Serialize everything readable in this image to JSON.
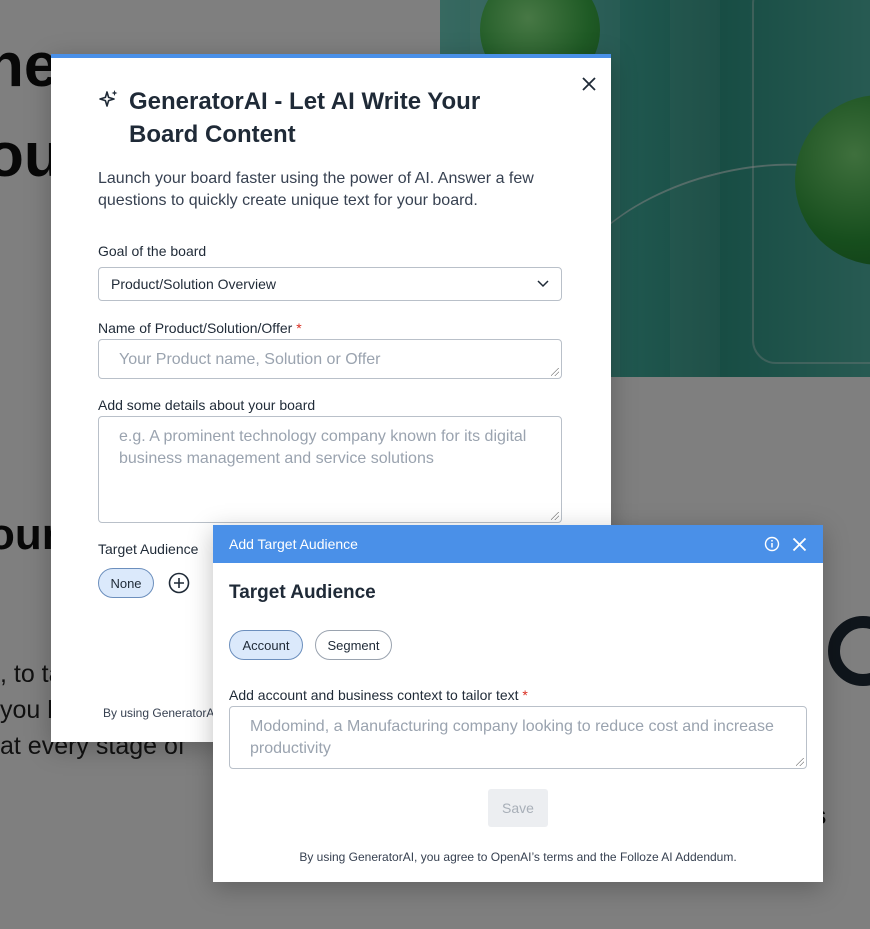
{
  "background_page": {
    "hero_line_1": "he",
    "hero_line_2": "ou",
    "section_heading": "our",
    "body_line_1": ", to ta",
    "body_line_2": "you b",
    "body_line_3": "at every stage of",
    "right_fragment": "s"
  },
  "main_modal": {
    "title": "GeneratorAI - Let AI Write Your Board Content",
    "subtitle": "Launch your board faster using the power of AI. Answer a few questions to quickly create unique text for your board.",
    "goal_label": "Goal of the board",
    "goal_selected": "Product/Solution Overview",
    "product_label": "Name of Product/Solution/Offer",
    "product_required_mark": "*",
    "product_placeholder": "Your Product name, Solution or Offer",
    "details_label": "Add some details about your board",
    "details_placeholder": "e.g. A prominent technology company known for its digital business management and service solutions",
    "audience_label": "Target Audience",
    "audience_chip": "None",
    "footer_text": "By using GeneratorA"
  },
  "popup": {
    "header_title": "Add Target Audience",
    "heading": "Target Audience",
    "tabs": [
      {
        "label": "Account",
        "active": true
      },
      {
        "label": "Segment",
        "active": false
      }
    ],
    "context_label": "Add account and business context to tailor text",
    "context_required_mark": "*",
    "context_placeholder": "Modomind, a Manufacturing company looking to reduce cost and increase productivity",
    "save_label": "Save",
    "footer_text": "By using GeneratorAI, you agree to OpenAI’s terms and the Folloze AI Addendum."
  },
  "icons": {
    "sparkle": "sparkle-icon",
    "close": "close-icon",
    "chevron": "chevron-down-icon",
    "add": "plus-circle-icon",
    "info": "info-icon"
  },
  "colors": {
    "accent": "#4a90e8",
    "chip_bg": "#dbe9fb",
    "required": "#d92d20",
    "placeholder": "#9aa3af"
  }
}
